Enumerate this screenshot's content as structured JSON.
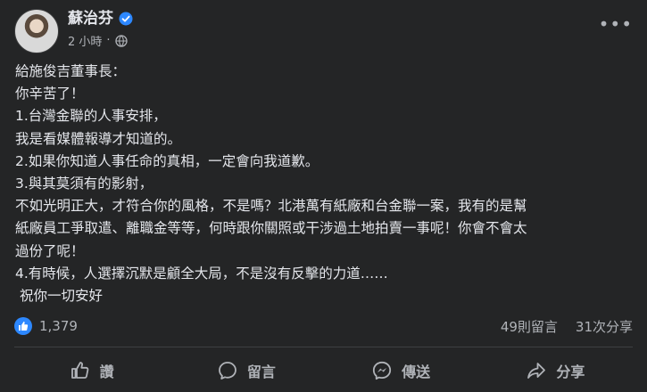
{
  "post": {
    "author": "蘇治芬",
    "time": "2 小時",
    "separator": "·",
    "more": "•••",
    "body": [
      "給施俊吉董事長：",
      "你辛苦了！",
      "1.台灣金聯的人事安排，",
      "我是看媒體報導才知道的。",
      "2.如果你知道人事任命的真相，一定會向我道歉。",
      "3.與其莫須有的影射，",
      "不如光明正大，才符合你的風格，不是嗎？北港萬有紙廠和台金聯一案，我有的是幫",
      "紙廠員工爭取遣、離職金等等，何時跟你關照或干涉過土地拍賣一事呢！你會不會太",
      "過份了呢！",
      "4.有時候，人選擇沉默是顧全大局，不是沒有反擊的力道……",
      " 祝你一切安好"
    ]
  },
  "stats": {
    "reactions": "1,379",
    "comments": "49則留言",
    "shares": "31次分享"
  },
  "actions": {
    "like": "讚",
    "comment": "留言",
    "send": "傳送",
    "share": "分享"
  },
  "colors": {
    "background": "#242526",
    "text": "#e4e6eb",
    "secondary": "#b0b3b8",
    "accent": "#2d88ff"
  },
  "icons": [
    "verified-icon",
    "globe-icon",
    "more-icon",
    "like-reaction-icon",
    "like-icon",
    "comment-icon",
    "messenger-icon",
    "share-icon"
  ]
}
